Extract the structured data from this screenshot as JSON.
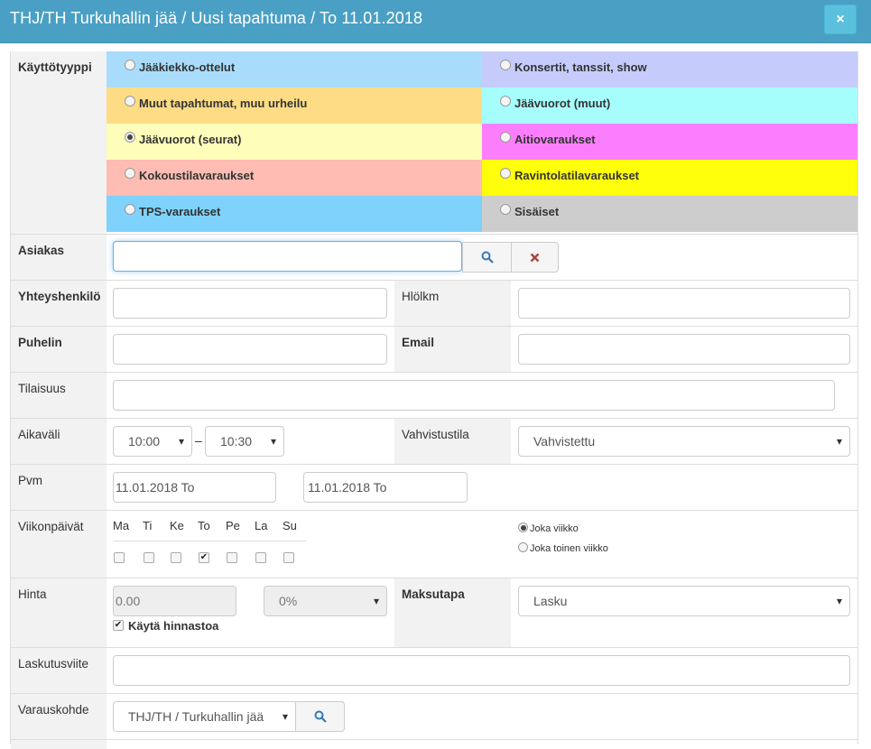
{
  "header": {
    "title": "THJ/TH Turkuhallin jää / Uusi tapahtuma / To 11.01.2018",
    "close": "×"
  },
  "usage": {
    "label": "Käyttötyyppi",
    "options": [
      {
        "label": "Jääkiekko-ottelut",
        "color": "#a9dcfb",
        "selected": false
      },
      {
        "label": "Konsertit, tanssit, show",
        "color": "#c5ccfb",
        "selected": false
      },
      {
        "label": "Muut tapahtumat, muu urheilu",
        "color": "#fedc85",
        "selected": false
      },
      {
        "label": "Jäävuorot (muut)",
        "color": "#a6fefc",
        "selected": false
      },
      {
        "label": "Jäävuorot (seurat)",
        "color": "#fefdba",
        "selected": true
      },
      {
        "label": "Aitiovaraukset",
        "color": "#fb7ffd",
        "selected": false
      },
      {
        "label": "Kokoustilavaraukset",
        "color": "#febcb3",
        "selected": false
      },
      {
        "label": "Ravintolatilavaraukset",
        "color": "#fffe0b",
        "selected": false
      },
      {
        "label": "TPS-varaukset",
        "color": "#7ed2fb",
        "selected": false
      },
      {
        "label": "Sisäiset",
        "color": "#cdcdcd",
        "selected": false
      }
    ]
  },
  "customer": {
    "label": "Asiakas",
    "value": ""
  },
  "contact": {
    "label": "Yhteyshenkilö",
    "value": "",
    "count_label": "Hlölkm",
    "count_value": ""
  },
  "phone": {
    "label": "Puhelin",
    "value": "",
    "email_label": "Email",
    "email_value": ""
  },
  "occasion": {
    "label": "Tilaisuus",
    "value": ""
  },
  "time": {
    "label": "Aikaväli",
    "start": "10:00",
    "sep": "–",
    "end": "10:30",
    "status_label": "Vahvistustila",
    "status": "Vahvistettu"
  },
  "date": {
    "label": "Pvm",
    "start": "11.01.2018 To",
    "end": "11.01.2018 To"
  },
  "weekdays": {
    "label": "Viikonpäivät",
    "days": [
      {
        "name": "Ma",
        "checked": false
      },
      {
        "name": "Ti",
        "checked": false
      },
      {
        "name": "Ke",
        "checked": false
      },
      {
        "name": "To",
        "checked": true
      },
      {
        "name": "Pe",
        "checked": false
      },
      {
        "name": "La",
        "checked": false
      },
      {
        "name": "Su",
        "checked": false
      }
    ],
    "every_week": "Joka viikko",
    "every_other_week": "Joka toinen viikko"
  },
  "price": {
    "label": "Hinta",
    "value": "0.00",
    "vat": "0%",
    "use_pricelist": "Käytä hinnastoa",
    "payment_label": "Maksutapa",
    "payment": "Lasku"
  },
  "invoice_ref": {
    "label": "Laskutusviite",
    "value": ""
  },
  "target": {
    "label": "Varauskohde",
    "value": "THJ/TH / Turkuhallin jää"
  },
  "icons": {
    "search": "search-icon",
    "clear": "times-icon",
    "check": "✔",
    "caret": "▾"
  }
}
